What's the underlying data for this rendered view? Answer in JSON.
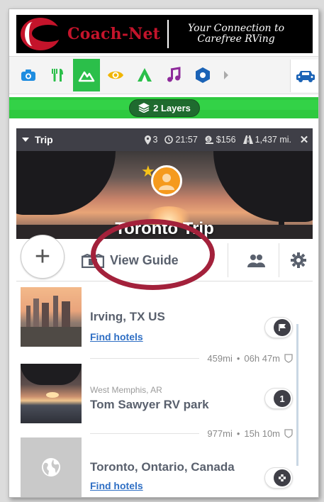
{
  "banner": {
    "brand": "Coach-Net",
    "tagline": "Your Connection to Carefree RVing"
  },
  "categories": [
    {
      "icon": "camera-icon",
      "color": "#1f8de0",
      "active": false
    },
    {
      "icon": "dining-icon",
      "color": "#2bbf4a",
      "active": false
    },
    {
      "icon": "mountain-icon",
      "color": "#ffffff",
      "active": true
    },
    {
      "icon": "eye-icon",
      "color": "#f0b500",
      "active": false
    },
    {
      "icon": "tent-icon",
      "color": "#2bbf4a",
      "active": false
    },
    {
      "icon": "music-icon",
      "color": "#8e2a9b",
      "active": false
    },
    {
      "icon": "hexagon-icon",
      "color": "#1b63b6",
      "active": false
    }
  ],
  "layers": {
    "label": "2 Layers"
  },
  "trip": {
    "label": "Trip",
    "stops": "3",
    "duration": "21:57",
    "cost": "$156",
    "distance": "1,437 mi.",
    "title": "Toronto Trip"
  },
  "actions": {
    "add": "+",
    "view_guide": "View Guide"
  },
  "stops": [
    {
      "name": "Irving, TX US",
      "link": "Find hotels",
      "marker": "flag"
    },
    {
      "subtitle": "West Memphis, AR",
      "name": "Tom Sawyer RV park",
      "marker": "1"
    },
    {
      "name": "Toronto, Ontario, Canada",
      "link": "Find hotels",
      "marker": "checkered"
    }
  ],
  "legs": [
    {
      "distance": "459mi",
      "time": "06h 47m"
    },
    {
      "distance": "977mi",
      "time": "15h 10m"
    }
  ],
  "colors": {
    "accent_green": "#2ec93f",
    "highlight": "#a3213b",
    "link": "#2f6fc4",
    "header": "#3f3f47"
  }
}
